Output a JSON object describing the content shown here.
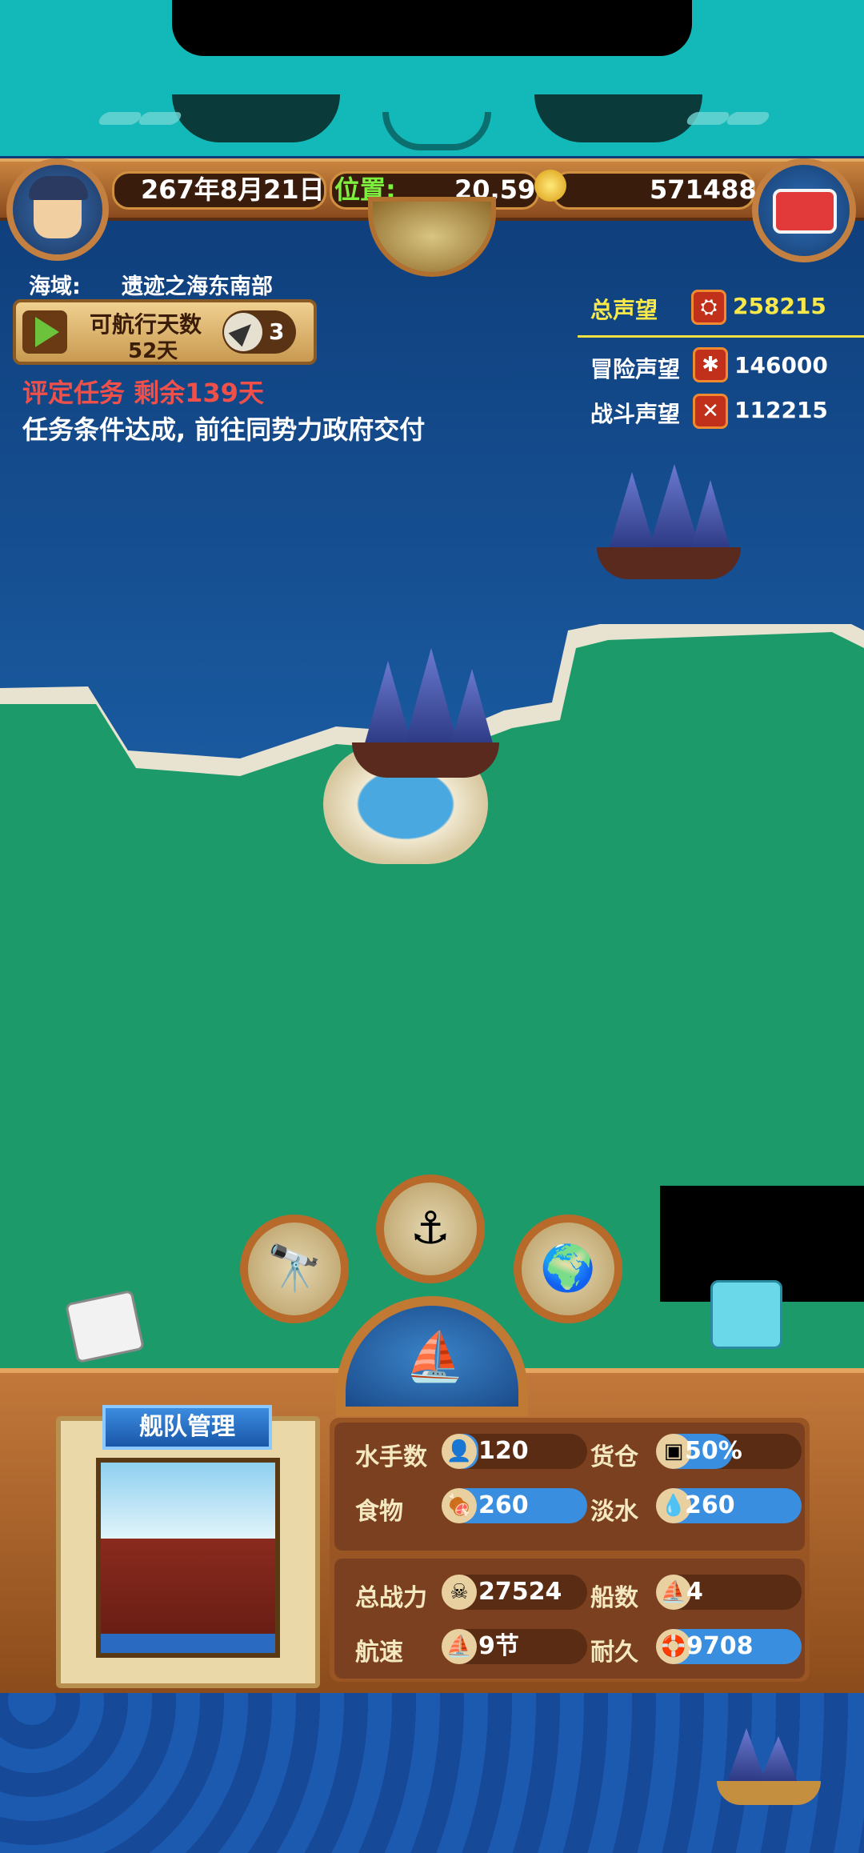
{
  "topbar": {
    "date": "267年8月21日",
    "position_label": "位置:",
    "position_value": "20,59",
    "gold": "571488"
  },
  "info": {
    "sea_label": "海域:",
    "sea_name": "遗迹之海东南部",
    "sail_days_label": "可航行天数",
    "sail_days_value": "52天",
    "nav_count": "3",
    "task_title": "评定任务 剩余139天",
    "task_desc": "任务条件达成, 前往同势力政府交付"
  },
  "reputation": {
    "total_label": "总声望",
    "total_value": "258215",
    "adventure_label": "冒险声望",
    "adventure_value": "146000",
    "battle_label": "战斗声望",
    "battle_value": "112215"
  },
  "actions": [
    {
      "name": "telescope-button",
      "icon": "🔭"
    },
    {
      "name": "anchor-button",
      "icon": "⚓"
    },
    {
      "name": "world-map-button",
      "icon": "🌍"
    },
    {
      "name": "harbor-button",
      "icon": "⛵"
    }
  ],
  "fleet": {
    "title": "舰队管理",
    "stats": {
      "sailors_label": "水手数",
      "sailors_value": "120",
      "cargo_label": "货仓",
      "cargo_value": "50%",
      "food_label": "食物",
      "food_value": "260",
      "water_label": "淡水",
      "water_value": "260",
      "power_label": "总战力",
      "power_value": "27524",
      "ships_label": "船数",
      "ships_value": "4",
      "speed_label": "航速",
      "speed_value": "9节",
      "durability_label": "耐久",
      "durability_value": "9708"
    },
    "fills": {
      "sailors": 0.05,
      "cargo": 0.25,
      "food": 1.0,
      "water": 1.0,
      "durability": 1.0
    }
  },
  "colors": {
    "task_red": "#f0504a",
    "rep_yellow": "#f8e84a",
    "position_green": "#7ef040",
    "stat_blue": "#3a8ee0"
  }
}
